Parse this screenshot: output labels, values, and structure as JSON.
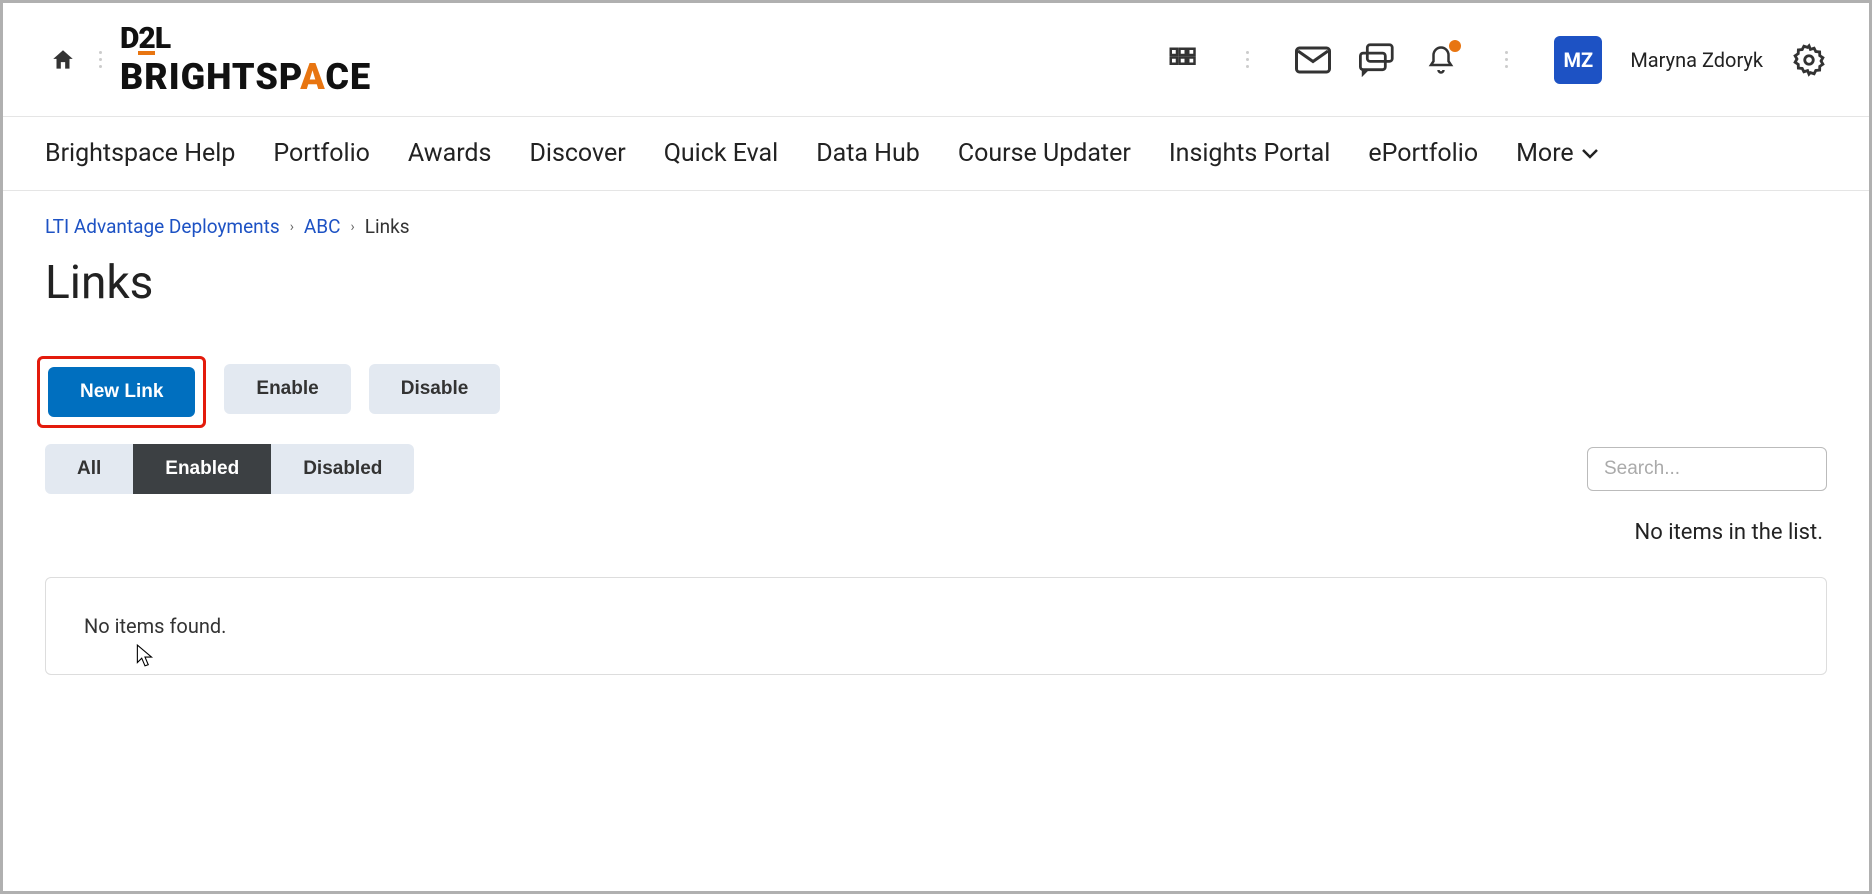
{
  "header": {
    "logo_top": "D2L",
    "logo_bottom_left": "BRIGHTSP",
    "logo_bottom_a": "A",
    "logo_bottom_right": "CE",
    "user": {
      "initials": "MZ",
      "name": "Maryna Zdoryk"
    }
  },
  "nav": {
    "items": [
      "Brightspace Help",
      "Portfolio",
      "Awards",
      "Discover",
      "Quick Eval",
      "Data Hub",
      "Course Updater",
      "Insights Portal",
      "ePortfolio"
    ],
    "more": "More"
  },
  "breadcrumb": {
    "items": [
      "LTI Advantage Deployments",
      "ABC"
    ],
    "current": "Links"
  },
  "page": {
    "title": "Links",
    "new_link": "New Link",
    "enable": "Enable",
    "disable": "Disable",
    "filters": {
      "all": "All",
      "enabled": "Enabled",
      "disabled": "Disabled"
    },
    "search_placeholder": "Search...",
    "no_items_label": "No items in the list.",
    "empty_message": "No items found."
  }
}
